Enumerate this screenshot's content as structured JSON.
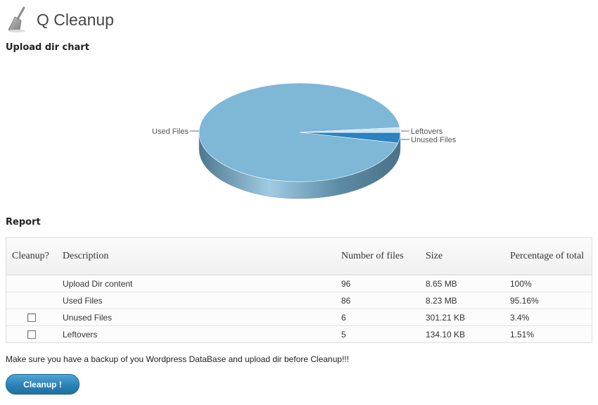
{
  "header": {
    "title": "Q Cleanup",
    "icon": "broom-icon"
  },
  "chart_section": {
    "title": "Upload dir chart"
  },
  "chart_data": {
    "type": "pie",
    "style": "3d",
    "slices": [
      {
        "label": "Used Files",
        "value": 8.23,
        "color": "#7fb7d7"
      },
      {
        "label": "Leftovers",
        "value": 0.131,
        "color": "#d0e4f0"
      },
      {
        "label": "Unused Files",
        "value": 0.294,
        "color": "#2a82c0"
      }
    ]
  },
  "report": {
    "title": "Report",
    "columns": [
      "Cleanup?",
      "Description",
      "Number of files",
      "Size",
      "Percentage of total"
    ],
    "rows": [
      {
        "checkbox": false,
        "description": "Upload Dir content",
        "files": "96",
        "size": "8.65 MB",
        "percent": "100%"
      },
      {
        "checkbox": false,
        "description": "Used Files",
        "files": "86",
        "size": "8.23 MB",
        "percent": "95.16%"
      },
      {
        "checkbox": true,
        "checked": false,
        "description": "Unused Files",
        "files": "6",
        "size": "301.21 KB",
        "percent": "3.4%"
      },
      {
        "checkbox": true,
        "checked": false,
        "description": "Leftovers",
        "files": "5",
        "size": "134.10 KB",
        "percent": "1.51%"
      }
    ]
  },
  "warning": "Make sure you have a backup of you Wordpress DataBase and upload dir before Cleanup!!!",
  "button": {
    "label": "Cleanup !"
  }
}
